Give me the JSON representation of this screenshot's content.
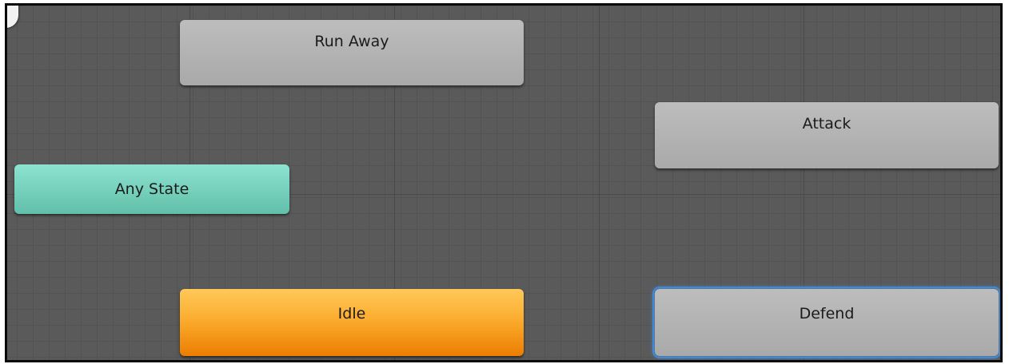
{
  "window": {
    "title": "",
    "canvas_background": "#5a5a5a"
  },
  "states": {
    "run_away": {
      "label": "Run Away",
      "color": "#b3b3b3"
    },
    "attack": {
      "label": "Attack",
      "color": "#b3b3b3"
    },
    "any_state": {
      "label": "Any State",
      "color": "#76d1bc"
    },
    "idle": {
      "label": "Idle",
      "color": "#f7a42a",
      "is_default": true
    },
    "defend": {
      "label": "Defend",
      "color": "#b3b3b3",
      "selected": true,
      "selection_color": "#3d8bd8"
    }
  }
}
